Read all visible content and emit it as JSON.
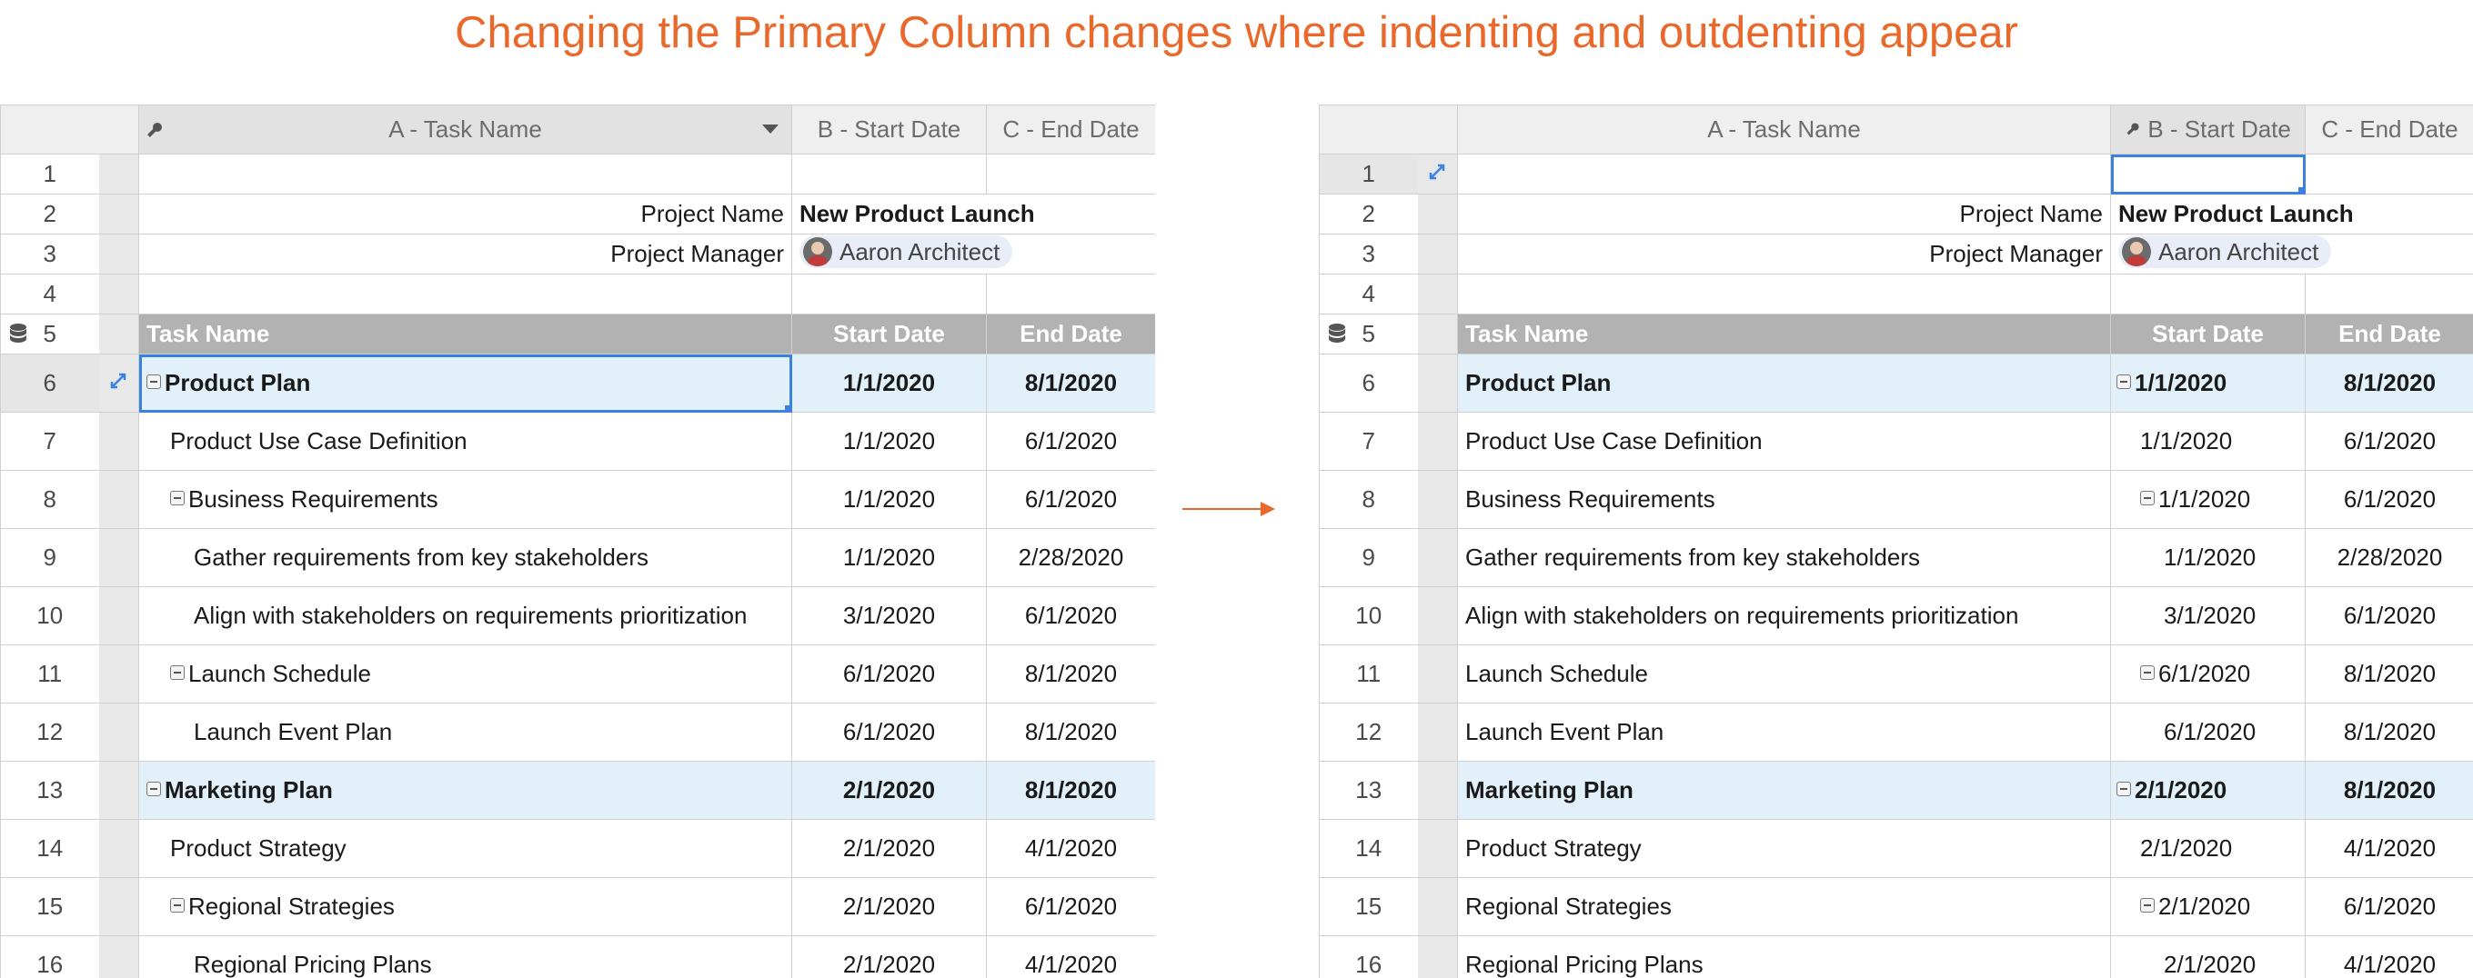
{
  "title": "Changing the Primary Column changes where indenting and outdenting appear",
  "colors": {
    "accent": "#e8692b",
    "selection": "#3b82e0",
    "parent_row": "#e2f0fa",
    "section_header": "#b2b2b2"
  },
  "left_sheet": {
    "columns": [
      "A - Task Name",
      "B - Start Date",
      "C - End Date"
    ],
    "primary_column": "A - Task Name",
    "rows": [
      {
        "n": "1"
      },
      {
        "n": "2",
        "label": "Project Name",
        "value": "New Product Launch"
      },
      {
        "n": "3",
        "label": "Project Manager",
        "contact": "Aaron Architect"
      },
      {
        "n": "4"
      },
      {
        "n": "5",
        "h1": "Task Name",
        "h2": "Start Date",
        "h3": "End Date"
      },
      {
        "n": "6",
        "task": "Product Plan",
        "start": "1/1/2020",
        "end": "8/1/2020"
      },
      {
        "n": "7",
        "task": "Product Use Case Definition",
        "start": "1/1/2020",
        "end": "6/1/2020"
      },
      {
        "n": "8",
        "task": "Business Requirements",
        "start": "1/1/2020",
        "end": "6/1/2020"
      },
      {
        "n": "9",
        "task": "Gather requirements from key stakeholders",
        "start": "1/1/2020",
        "end": "2/28/2020"
      },
      {
        "n": "10",
        "task": "Align with stakeholders on requirements prioritization",
        "start": "3/1/2020",
        "end": "6/1/2020"
      },
      {
        "n": "11",
        "task": "Launch Schedule",
        "start": "6/1/2020",
        "end": "8/1/2020"
      },
      {
        "n": "12",
        "task": "Launch Event Plan",
        "start": "6/1/2020",
        "end": "8/1/2020"
      },
      {
        "n": "13",
        "task": "Marketing Plan",
        "start": "2/1/2020",
        "end": "8/1/2020"
      },
      {
        "n": "14",
        "task": "Product Strategy",
        "start": "2/1/2020",
        "end": "4/1/2020"
      },
      {
        "n": "15",
        "task": "Regional Strategies",
        "start": "2/1/2020",
        "end": "6/1/2020"
      },
      {
        "n": "16",
        "task": "Regional Pricing Plans",
        "start": "2/1/2020",
        "end": "4/1/2020"
      }
    ]
  },
  "right_sheet": {
    "columns": [
      "A - Task Name",
      "B - Start Date",
      "C - End Date"
    ],
    "primary_column": "B - Start Date",
    "rows": [
      {
        "n": "1"
      },
      {
        "n": "2",
        "label": "Project Name",
        "value": "New Product Launch"
      },
      {
        "n": "3",
        "label": "Project Manager",
        "contact": "Aaron Architect"
      },
      {
        "n": "4"
      },
      {
        "n": "5",
        "h1": "Task Name",
        "h2": "Start Date",
        "h3": "End Date"
      },
      {
        "n": "6",
        "task": "Product Plan",
        "start": "1/1/2020",
        "end": "8/1/2020"
      },
      {
        "n": "7",
        "task": "Product Use Case Definition",
        "start": "1/1/2020",
        "end": "6/1/2020"
      },
      {
        "n": "8",
        "task": "Business Requirements",
        "start": "1/1/2020",
        "end": "6/1/2020"
      },
      {
        "n": "9",
        "task": "Gather requirements from key stakeholders",
        "start": "1/1/2020",
        "end": "2/28/2020"
      },
      {
        "n": "10",
        "task": "Align with stakeholders on requirements prioritization",
        "start": "3/1/2020",
        "end": "6/1/2020"
      },
      {
        "n": "11",
        "task": "Launch Schedule",
        "start": "6/1/2020",
        "end": "8/1/2020"
      },
      {
        "n": "12",
        "task": "Launch Event Plan",
        "start": "6/1/2020",
        "end": "8/1/2020"
      },
      {
        "n": "13",
        "task": "Marketing Plan",
        "start": "2/1/2020",
        "end": "8/1/2020"
      },
      {
        "n": "14",
        "task": "Product Strategy",
        "start": "2/1/2020",
        "end": "4/1/2020"
      },
      {
        "n": "15",
        "task": "Regional Strategies",
        "start": "2/1/2020",
        "end": "6/1/2020"
      },
      {
        "n": "16",
        "task": "Regional Pricing Plans",
        "start": "2/1/2020",
        "end": "4/1/2020"
      }
    ]
  }
}
